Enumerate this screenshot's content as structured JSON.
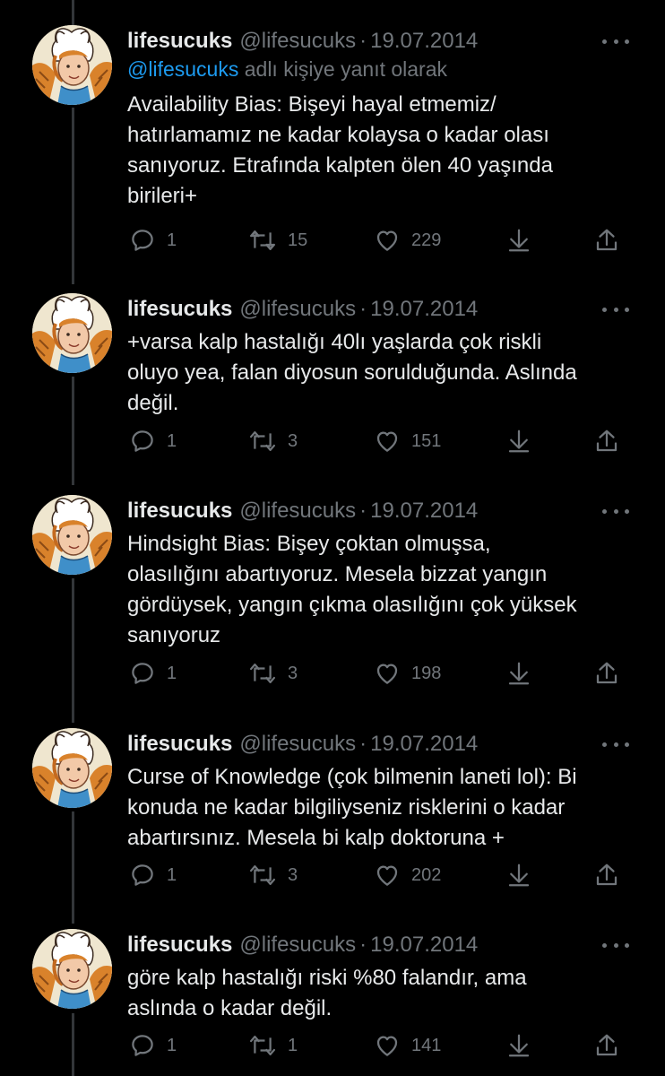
{
  "author": {
    "name": "lifesucuks",
    "handle": "@lifesucuks"
  },
  "reply_context": {
    "mention": "@lifesucuks",
    "suffix": "adlı kişiye yanıt olarak"
  },
  "icons": {
    "reply": "comment-bubble-icon",
    "retweet": "retweet-arrows-icon",
    "like": "heart-outline-icon",
    "download": "download-arrow-icon",
    "share": "share-upload-icon",
    "more": "more-dots-icon"
  },
  "colors": {
    "background": "#000000",
    "text": "#e7e9ea",
    "secondary": "#71767b",
    "link": "#1d9bf0",
    "thread_line": "#333639"
  },
  "tweets": [
    {
      "date": "19.07.2014",
      "text": "Availability Bias: Bişeyi hayal etmemiz/\nhatırlamamız ne kadar kolaysa o kadar olası\nsanıyoruz. Etrafında kalpten ölen 40 yaşında\nbirileri+",
      "replies": "1",
      "retweets": "15",
      "likes": "229"
    },
    {
      "date": "19.07.2014",
      "text": "+varsa kalp hastalığı 40lı yaşlarda çok riskli\noluyo yea, falan diyosun sorulduğunda. Aslında\ndeğil.",
      "replies": "1",
      "retweets": "3",
      "likes": "151"
    },
    {
      "date": "19.07.2014",
      "text": "Hindsight Bias: Bişey çoktan olmuşsa,\nolasılığını abartıyoruz. Mesela bizzat yangın\ngördüysek, yangın çıkma olasılığını çok yüksek\nsanıyoruz",
      "replies": "1",
      "retweets": "3",
      "likes": "198"
    },
    {
      "date": "19.07.2014",
      "text": "Curse of Knowledge (çok bilmenin laneti lol): Bi\nkonuda ne kadar bilgiliyseniz risklerini o kadar\nabartırsınız. Mesela bi kalp doktoruna +",
      "replies": "1",
      "retweets": "3",
      "likes": "202"
    },
    {
      "date": "19.07.2014",
      "text": "göre kalp hastalığı riski %80 falandır, ama\naslında o kadar değil.",
      "replies": "1",
      "retweets": "1",
      "likes": "141"
    }
  ]
}
